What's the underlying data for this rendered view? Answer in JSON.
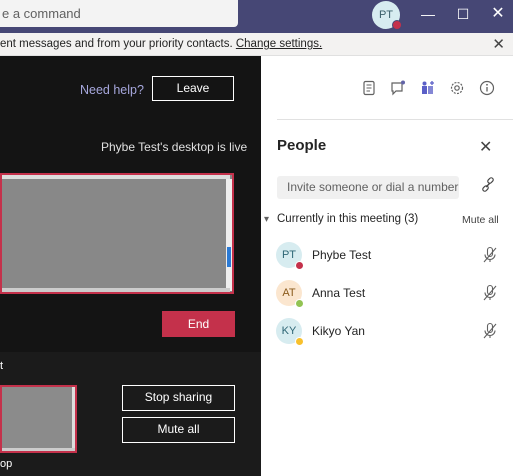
{
  "titlebar": {
    "search_text": "e a command",
    "avatar_initials": "PT",
    "status_color": "#c4314b",
    "min_icon": "minimize-icon",
    "max_icon": "maximize-icon",
    "close_icon": "close-icon"
  },
  "notice": {
    "text": "ent messages and from your priority contacts. ",
    "link": "Change settings."
  },
  "stage": {
    "help": "Need help?",
    "leave": "Leave",
    "live_text": "Phybe Test's desktop is live",
    "end": "End"
  },
  "bottom": {
    "label_top": "t",
    "label_bottom": "op",
    "stop_sharing": "Stop sharing",
    "mute_all": "Mute all"
  },
  "side": {
    "tools": [
      "notes-icon",
      "chat-icon",
      "apps-icon",
      "settings-icon",
      "info-icon"
    ],
    "title": "People",
    "invite_placeholder": "Invite someone or dial a number",
    "section_label": "Currently in this meeting",
    "count": "(3)",
    "mute_all": "Mute all",
    "people": [
      {
        "initials": "PT",
        "name": "Phybe Test",
        "bg": "#d7ecf0",
        "fg": "#2e6675",
        "status": "#c4314b"
      },
      {
        "initials": "AT",
        "name": "Anna Test",
        "bg": "#fbe6cf",
        "fg": "#8a5a1b",
        "status": "#92c353"
      },
      {
        "initials": "KY",
        "name": "Kikyo Yan",
        "bg": "#d7ecf0",
        "fg": "#2e6675",
        "status": "#f8c02c"
      }
    ]
  }
}
